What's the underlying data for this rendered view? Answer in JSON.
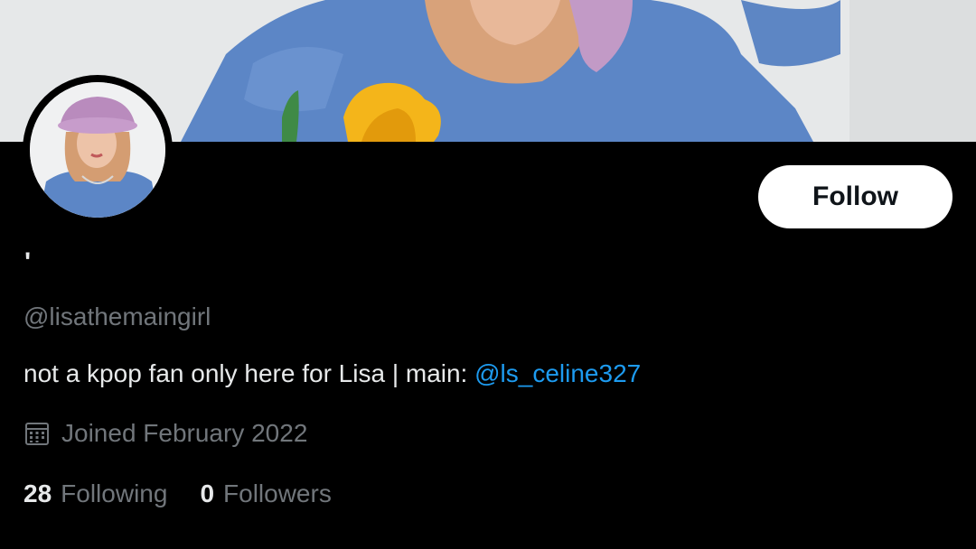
{
  "profile": {
    "display_name": "'",
    "handle": "@lisathemaingirl",
    "bio_text": "not a kpop fan only here for Lisa | main: ",
    "bio_mention": "@ls_celine327",
    "joined": "Joined February 2022",
    "follow_label": "Follow",
    "stats": {
      "following_count": "28",
      "following_label": "Following",
      "followers_count": "0",
      "followers_label": "Followers"
    }
  },
  "icons": {
    "joined": "calendar-icon"
  },
  "colors": {
    "background": "#000000",
    "primary_text": "#e7e9ea",
    "secondary_text": "#71767b",
    "mention": "#1d9bf0",
    "follow_button_bg": "#ffffff",
    "follow_button_text": "#0f1419"
  }
}
